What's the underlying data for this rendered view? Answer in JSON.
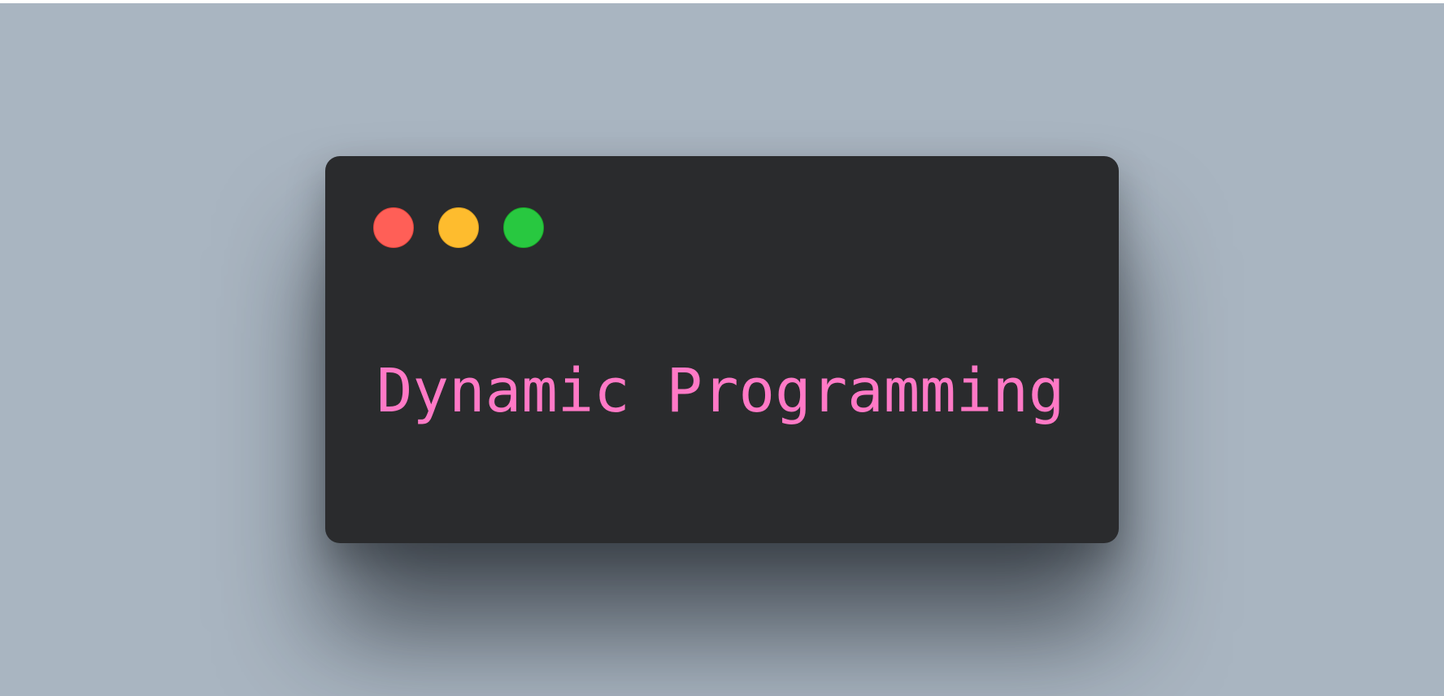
{
  "window": {
    "controls": [
      {
        "name": "close",
        "color": "#ff5f57"
      },
      {
        "name": "minimize",
        "color": "#febc2e"
      },
      {
        "name": "zoom",
        "color": "#28c840"
      }
    ],
    "code_text": "Dynamic Programming",
    "text_color": "#ff79c6",
    "background_color": "#2a2b2d"
  },
  "canvas": {
    "background_color": "#a9b5c1"
  }
}
